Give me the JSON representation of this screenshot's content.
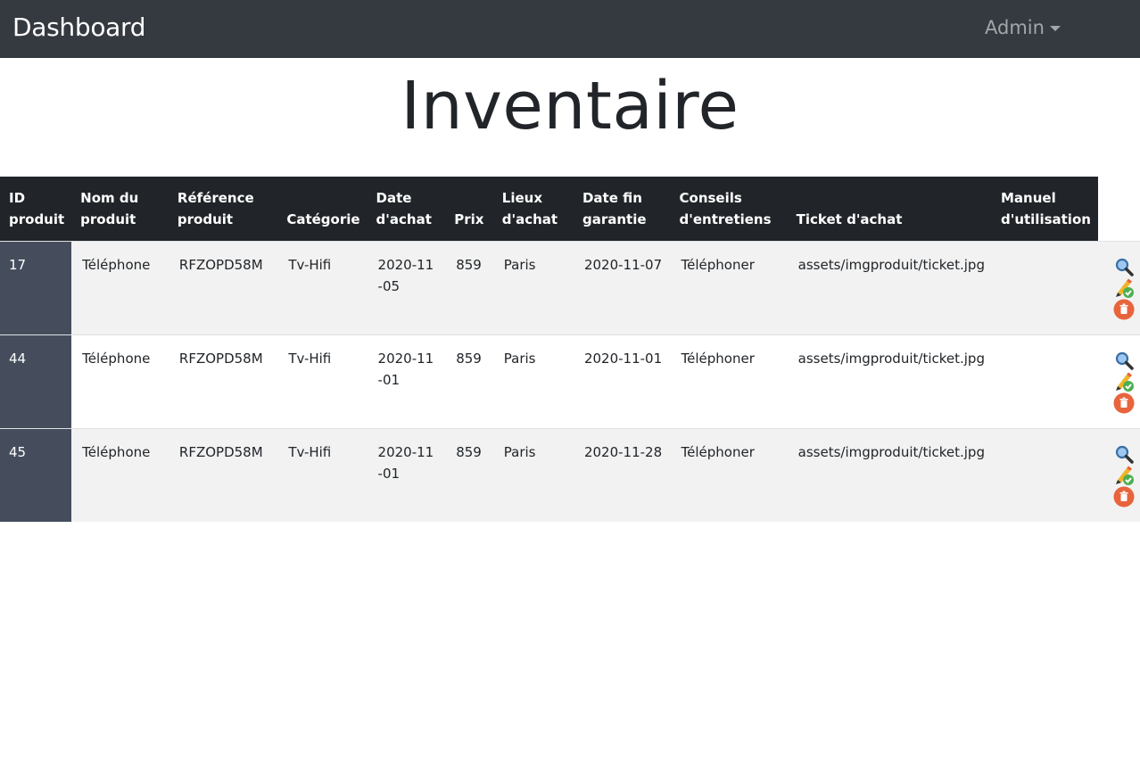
{
  "navbar": {
    "brand": "Dashboard",
    "user_menu": "Admin"
  },
  "page": {
    "title": "Inventaire"
  },
  "table": {
    "headers": [
      "ID produit",
      "Nom du produit",
      "Référence produit",
      "Catégorie",
      "Date d'achat",
      "Prix",
      "Lieux d'achat",
      "Date fin garantie",
      "Conseils d'entretiens",
      "Ticket d'achat",
      "Manuel d'utilisation"
    ],
    "rows": [
      {
        "id": "17",
        "name": "Téléphone",
        "ref": "RFZOPD58M",
        "category": "Tv-Hifi",
        "purchase_date": "2020-11-05",
        "price": "859",
        "place": "Paris",
        "warranty_end": "2020-11-07",
        "care": "Téléphoner",
        "ticket": "assets/imgproduit/ticket.jpg",
        "manual": ""
      },
      {
        "id": "44",
        "name": "Téléphone",
        "ref": "RFZOPD58M",
        "category": "Tv-Hifi",
        "purchase_date": "2020-11-01",
        "price": "859",
        "place": "Paris",
        "warranty_end": "2020-11-01",
        "care": "Téléphoner",
        "ticket": "assets/imgproduit/ticket.jpg",
        "manual": ""
      },
      {
        "id": "45",
        "name": "Téléphone",
        "ref": "RFZOPD58M",
        "category": "Tv-Hifi",
        "purchase_date": "2020-11-01",
        "price": "859",
        "place": "Paris",
        "warranty_end": "2020-11-28",
        "care": "Téléphoner",
        "ticket": "assets/imgproduit/ticket.jpg",
        "manual": ""
      }
    ],
    "row_actions": [
      "view-icon",
      "edit-icon",
      "delete-icon"
    ]
  },
  "colors": {
    "navbar": "#343a40",
    "table_header": "#212529",
    "id_column": "#454d5d",
    "row_stripe": "#f2f2f2",
    "delete": "#e8643c",
    "edit_check": "#4caf50"
  }
}
